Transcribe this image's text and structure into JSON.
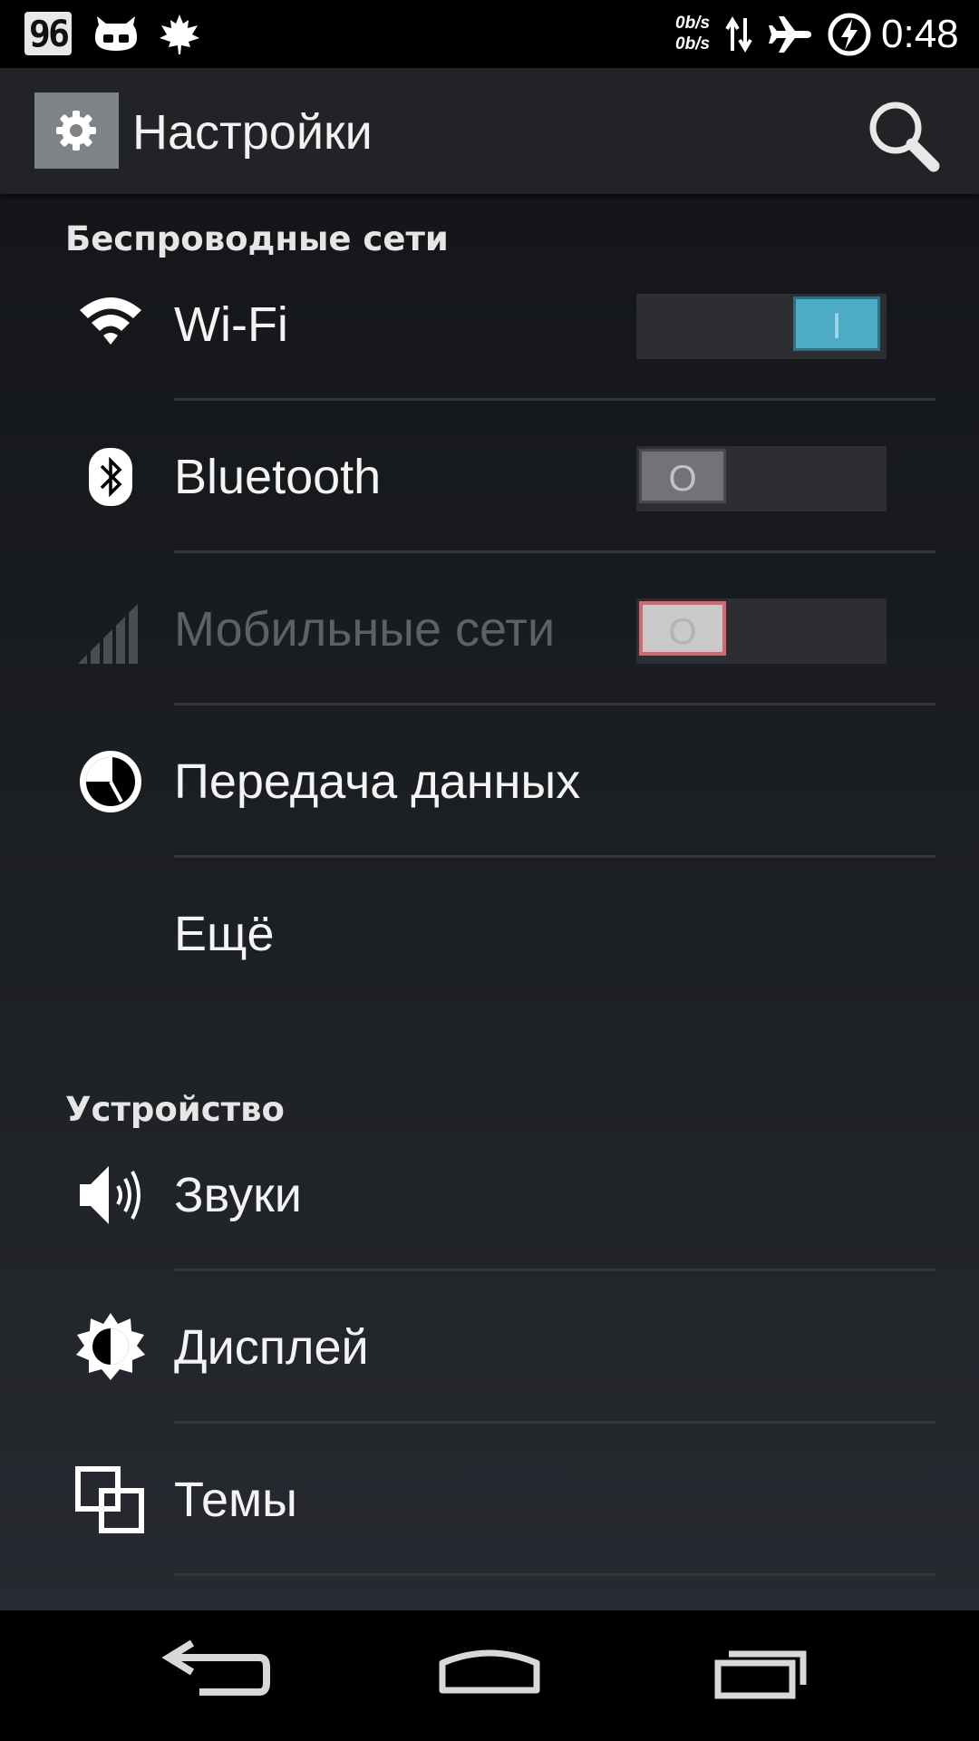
{
  "status_bar": {
    "battery_level": "96",
    "net_speed_up": "0b/s",
    "net_speed_down": "0b/s",
    "time": "0:48",
    "icons": [
      "battery-icon",
      "cyanogen-icon",
      "leaf-icon",
      "data-activity-icon",
      "airplane-mode-icon",
      "power-icon"
    ]
  },
  "action_bar": {
    "title": "Настройки",
    "icons": [
      "settings-gear-icon",
      "search-icon"
    ]
  },
  "sections": {
    "wireless": {
      "header": "Беспроводные сети",
      "items": [
        {
          "label": "Wi-Fi",
          "icon": "wifi-icon",
          "switch": "on",
          "switch_text": "I"
        },
        {
          "label": "Bluetooth",
          "icon": "bluetooth-icon",
          "switch": "off",
          "switch_text": "O"
        },
        {
          "label": "Мобильные сети",
          "icon": "mobile-signal-icon",
          "switch": "off",
          "switch_text": "O",
          "disabled": true
        },
        {
          "label": "Передача данных",
          "icon": "data-usage-icon"
        },
        {
          "label": "Ещё"
        }
      ]
    },
    "device": {
      "header": "Устройство",
      "items": [
        {
          "label": "Звуки",
          "icon": "volume-icon"
        },
        {
          "label": "Дисплей",
          "icon": "brightness-icon"
        },
        {
          "label": "Темы",
          "icon": "themes-icon"
        }
      ]
    }
  },
  "nav_bar": {
    "icons": [
      "back-icon",
      "home-icon",
      "recents-icon"
    ]
  },
  "colors": {
    "accent_switch_on": "#4cacc8",
    "switch_track": "#2c2e31",
    "disabled_thumb_border": "#d2686d",
    "action_bar": "#212326"
  }
}
